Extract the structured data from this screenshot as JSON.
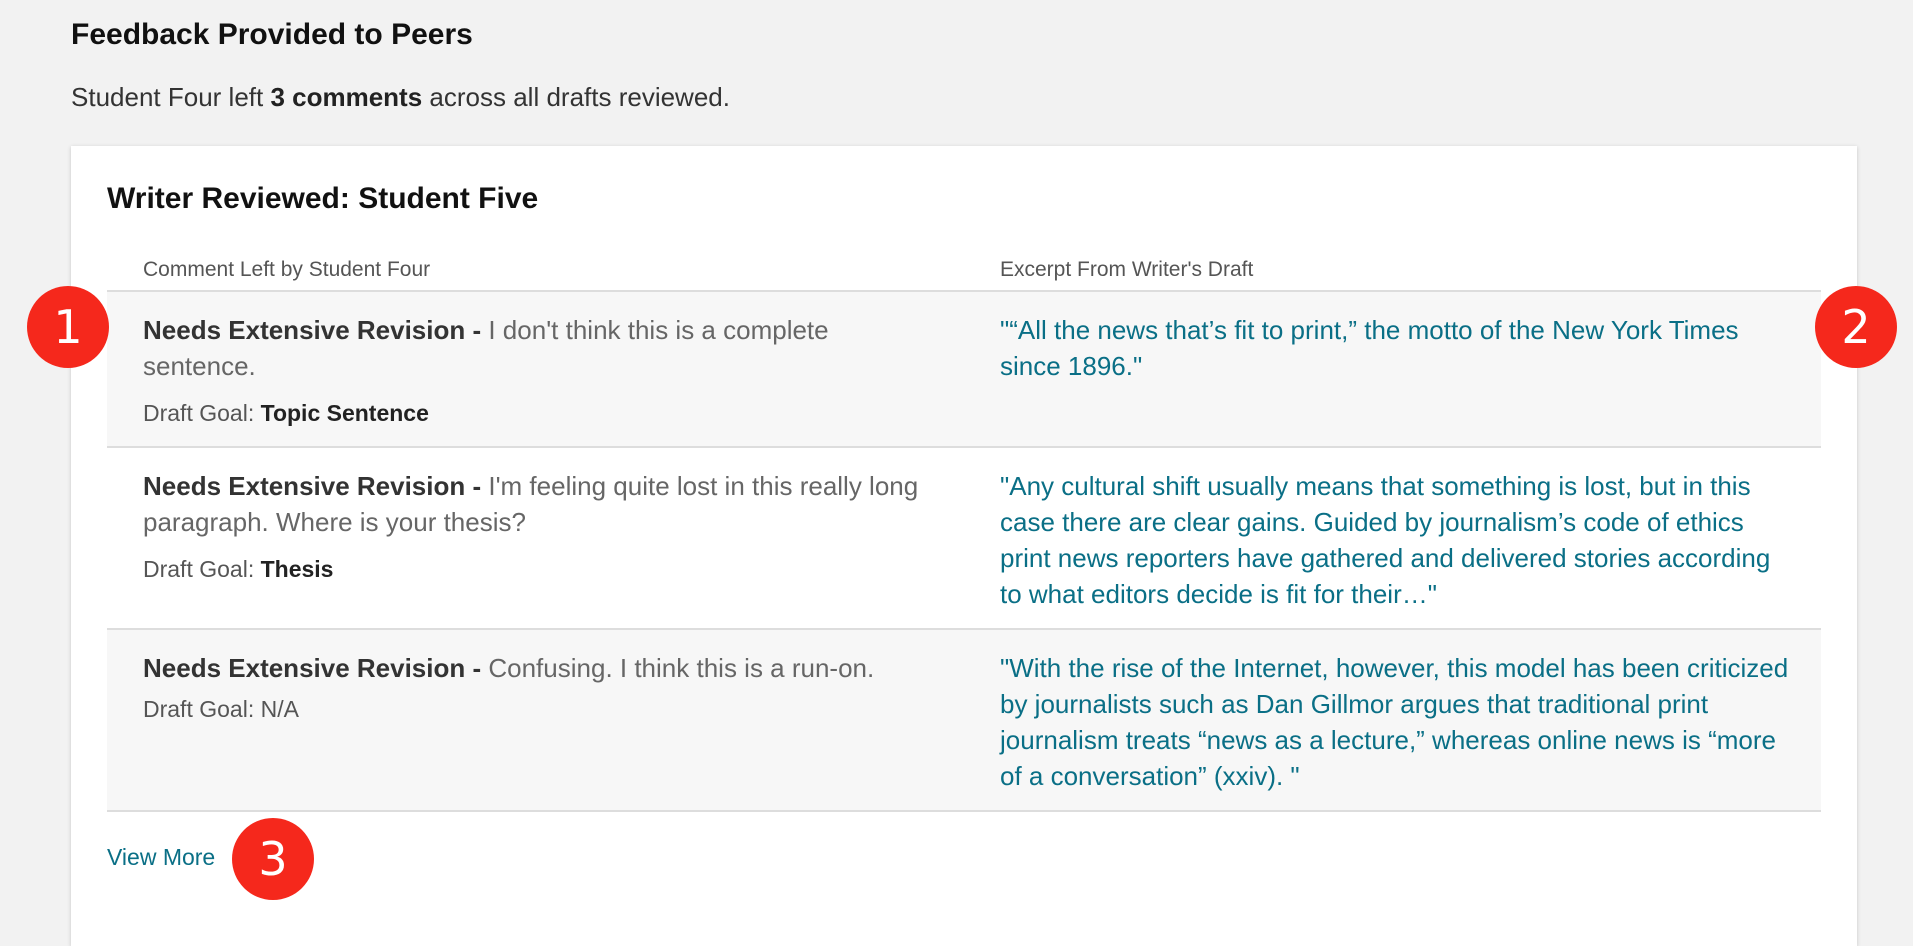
{
  "section": {
    "title": "Feedback Provided to Peers",
    "summary_prefix": "Student Four left ",
    "summary_count": "3 comments",
    "summary_suffix": " across all drafts reviewed."
  },
  "review": {
    "writer_title": "Writer Reviewed: Student Five",
    "col_comment": "Comment Left by Student Four",
    "col_excerpt": "Excerpt From Writer's Draft",
    "rows": [
      {
        "rating": "Needs Extensive Revision -",
        "comment": " I don't think this is a complete sentence.",
        "goal_label": "Draft Goal: ",
        "goal_value": "Topic Sentence",
        "excerpt": "\"“All the news that’s fit to print,” the motto of the New York Times since 1896.\""
      },
      {
        "rating": "Needs Extensive Revision -",
        "comment": " I'm feeling quite lost in this really long paragraph. Where is your thesis?",
        "goal_label": "Draft Goal: ",
        "goal_value": "Thesis",
        "excerpt": "\"Any cultural shift usually means that something is lost, but in this case there are clear gains. Guided by journalism’s code of ethics print news reporters have gathered and delivered stories according to what editors decide is fit for their…\""
      },
      {
        "rating": "Needs Extensive Revision -",
        "comment": " Confusing. I think this is a run-on.",
        "goal_label": "Draft Goal: N/A",
        "goal_value": "",
        "excerpt": "\"With the rise of the Internet, however, this model has been criticized by journalists such as Dan Gillmor argues that traditional print journalism treats “news as a lecture,” whereas online news is “more of a conversation” (xxiv). \""
      }
    ],
    "view_more": "View More"
  },
  "markers": [
    "1",
    "2",
    "3"
  ],
  "colors": {
    "link": "#0a6f86",
    "marker": "#f5281c",
    "background": "#f2f2f2"
  }
}
